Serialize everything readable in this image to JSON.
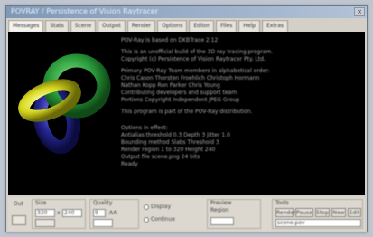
{
  "window": {
    "title": "POVRAY / Persistence of Vision Raytracer",
    "close_label": "×"
  },
  "tabs": [
    {
      "label": "Messages"
    },
    {
      "label": "Stats"
    },
    {
      "label": "Scene"
    },
    {
      "label": "Output"
    },
    {
      "label": "Render"
    },
    {
      "label": "Options"
    },
    {
      "label": "Editor"
    },
    {
      "label": "Files"
    },
    {
      "label": "Help"
    },
    {
      "label": "Extras"
    }
  ],
  "console": {
    "lines": [
      "POV-Ray is based on DKBTrace 2.12",
      "This is an unofficial build of the 3D ray tracing program.",
      "Copyright (c) Persistence of Vision Raytracer Pty. Ltd.",
      "",
      "Primary POV-Ray Team members in alphabetical order:",
      "Chris Cason   Thorsten Froehlich   Christoph Hormann",
      "Nathan Kopp   Ron Parker   Chris Young",
      "Contributing developers and support team",
      "Portions Copyright Independent JPEG Group",
      "",
      "This program is part of the POV-Ray distribution.",
      "",
      "Options in effect:",
      "Antialias threshold 0.3  Depth 3  Jitter 1.0",
      "Bounding method  Slabs  Threshold 3",
      "Render region 1 to 320  Height 240",
      "Output file  scene.png  24 bits",
      "Ready"
    ]
  },
  "controls": {
    "output_label": "Out",
    "size_label": "Size",
    "width_value": "320",
    "height_value": "240",
    "x_label": "x",
    "quality_label": "Quality",
    "quality_value": "9",
    "aa_label": "AA",
    "opt_a": "Display",
    "opt_b": "Continue",
    "preview_label": "Preview",
    "region_label": "Region",
    "tools_label": "Tools",
    "btn_render": "Render",
    "btn_pause": "Pause",
    "btn_stop": "Stop",
    "btn_new": "New",
    "btn_edit": "Edit",
    "file_value": "scene.pov"
  },
  "colors": {
    "console_bg": "#000000",
    "knot_green": "#2a9a3a",
    "knot_yellow": "#d8d820",
    "knot_blue": "#28289a"
  }
}
